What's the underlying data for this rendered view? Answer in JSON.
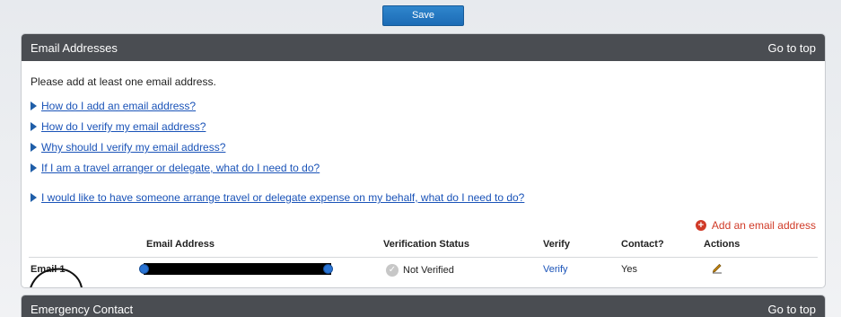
{
  "toolbar": {
    "save_label": "Save"
  },
  "email_section": {
    "title": "Email Addresses",
    "go_to_top": "Go to top",
    "intro": "Please add at least one email address.",
    "help_links": [
      "How do I add an email address?",
      "How do I verify my email address?",
      "Why should I verify my email address?",
      "If I am a travel arranger or delegate, what do I need to do?",
      "I would like to have someone arrange travel or delegate expense on my behalf, what do I need to do?"
    ],
    "add_label": "Add an email address",
    "columns": {
      "email": "Email Address",
      "status": "Verification Status",
      "verify": "Verify",
      "contact": "Contact?",
      "actions": "Actions"
    },
    "rows": [
      {
        "label": "Email 1",
        "status": "Not Verified",
        "verify": "Verify",
        "contact": "Yes"
      }
    ]
  },
  "emergency_section": {
    "title": "Emergency Contact",
    "go_to_top": "Go to top"
  },
  "colors": {
    "header_bg": "#4a4d52",
    "link": "#1a53b8",
    "add_accent": "#d03a27",
    "save_button": "#1c6bb5"
  },
  "icons": {
    "help": "triangle-right-icon",
    "add": "plus-circle-icon",
    "status": "check-circle-icon",
    "edit": "pencil-icon"
  }
}
